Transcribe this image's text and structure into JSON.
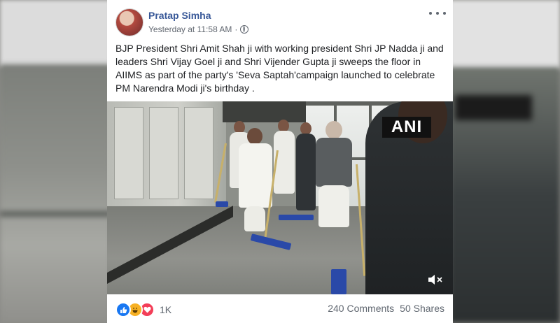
{
  "post": {
    "author": "Pratap Simha",
    "timestamp": "Yesterday at 11:58 AM",
    "separator": "·",
    "privacy_icon": "globe-icon",
    "menu_icon": "more-horizontal-icon",
    "text": "BJP President Shri Amit Shah ji with working president Shri JP Nadda ji and leaders Shri Vijay Goel ji and Shri Vijender Gupta ji sweeps the floor in AIIMS as part of the party's 'Seva Saptah'campaign launched to celebrate PM Narendra Modi ji's birthday .",
    "media": {
      "type": "video",
      "watermark": "ANI",
      "sound_icon": "speaker-muted-icon"
    }
  },
  "engagement": {
    "reactions": [
      "like",
      "haha",
      "love"
    ],
    "reaction_count": "1K",
    "comments": "240 Comments",
    "shares": "50 Shares"
  },
  "colors": {
    "author_link": "#385898",
    "like": "#1877f2",
    "haha": "#f7b125",
    "love": "#f33e58",
    "meta_text": "#616770"
  }
}
